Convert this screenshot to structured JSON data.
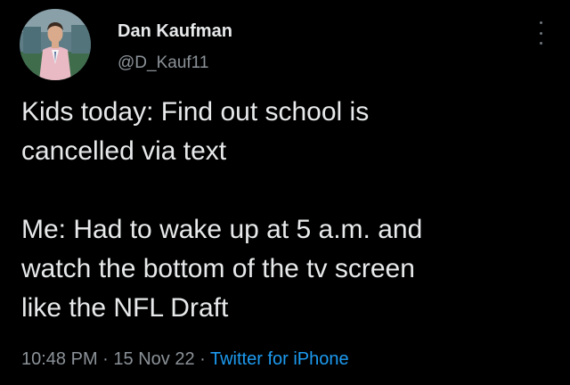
{
  "author": {
    "display_name": "Dan Kaufman",
    "handle": "@D_Kauf11"
  },
  "tweet": {
    "text": "Kids today: Find out school is\ncancelled via text\n\nMe: Had to wake up at 5 a.m. and\nwatch the bottom of the tv screen\nlike the NFL Draft",
    "time": "10:48 PM",
    "separator": " · ",
    "date": "15 Nov 22",
    "source": "Twitter for iPhone"
  },
  "icons": {
    "more": "more-options-icon",
    "avatar": "profile-photo"
  },
  "colors": {
    "background": "#000000",
    "text": "#e7e9ea",
    "secondary": "#8b9298",
    "link": "#1d9bf0"
  }
}
